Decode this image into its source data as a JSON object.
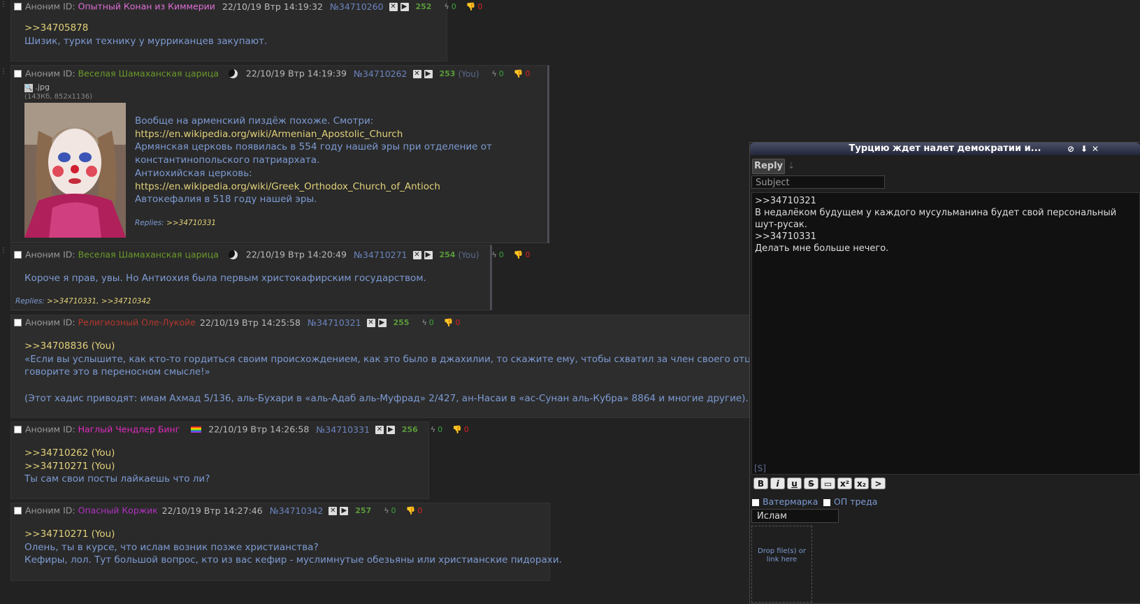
{
  "posts": [
    {
      "name": "Аноним",
      "id_label": "ID:",
      "id_name": "Опытный Конан из Киммерии",
      "date": "22/10/19 Втр 14:19:32",
      "num": "№34710260",
      "count": "252",
      "likes": "0",
      "dislikes": "0",
      "lines": [
        ">>34705878",
        "Шизик, турки технику у мурриканцев закупают."
      ]
    },
    {
      "name": "Аноним",
      "id_label": "ID:",
      "id_name": "Веселая Шамаханская царица",
      "date": "22/10/19 Втр 14:19:39",
      "num": "№34710262",
      "count": "253",
      "you": "(You)",
      "likes": "0",
      "dislikes": "0",
      "file_name": ".jpg",
      "file_info": "(143Кб, 852x1136)",
      "lines": [
        "Вообще на арменский пиздёж похоже. Смотри:",
        "https://en.wikipedia.org/wiki/Armenian_Apostolic_Church",
        "Армянская церковь появилась в 554 году нашей эры при отделение от",
        "константинопольского патриархата.",
        "Антиохийская церковь:",
        "https://en.wikipedia.org/wiki/Greek_Orthodox_Church_of_Antioch",
        "Автокефалия в 518 году нашей эры."
      ],
      "replies_label": "Replies:",
      "replies": ">>34710331"
    },
    {
      "name": "Аноним",
      "id_label": "ID:",
      "id_name": "Веселая Шамаханская царица",
      "date": "22/10/19 Втр 14:20:49",
      "num": "№34710271",
      "count": "254",
      "you": "(You)",
      "likes": "0",
      "dislikes": "0",
      "lines": [
        "Короче я прав, увы. Но Антиохия была первым христокафирским государством."
      ],
      "replies_label": "Replies:",
      "replies": ">>34710331, >>34710342"
    },
    {
      "name": "Аноним",
      "id_label": "ID:",
      "id_name": "Религиозный Оле-Лукойе",
      "date": "22/10/19 Втр 14:25:58",
      "num": "№34710321",
      "count": "255",
      "likes": "0",
      "dislikes": "0",
      "lines": [
        ">>34708836 (You)",
        "«Если вы услышите, как кто-то гордиться своим происхождением, как это было в джахилии, то скажите ему, чтобы схватил за член своего отца. И не",
        "говорите это в переносном смысле!»",
        "",
        "(Этот хадис приводят: имам Ахмад 5/136, аль-Бухари в «аль-Адаб аль-Муфрад» 2/427, ан-Насаи в «ас-Сунан аль-Кубра» 8864 и многие другие)."
      ]
    },
    {
      "name": "Аноним",
      "id_label": "ID:",
      "id_name": "Наглый Чендлер Бинг",
      "date": "22/10/19 Втр 14:26:58",
      "num": "№34710331",
      "count": "256",
      "likes": "0",
      "dislikes": "0",
      "lines": [
        ">>34710262 (You)",
        ">>34710271 (You)",
        "Ты сам свои посты лайкаешь что ли?"
      ]
    },
    {
      "name": "Аноним",
      "id_label": "ID:",
      "id_name": "Опасный Коржик",
      "date": "22/10/19 Втр 14:27:46",
      "num": "№34710342",
      "count": "257",
      "likes": "0",
      "dislikes": "0",
      "lines": [
        ">>34710271 (You)",
        "Олень, ты в курсе, что ислам возник позже христианства?",
        "Кефиры, лол. Тут большой вопрос, кто из вас кефир - муслимнутые обезьяны или христианские пидорахи."
      ]
    }
  ],
  "reply_window": {
    "title": "Турцию ждет налет демократии и...",
    "reply_button": "Reply",
    "subject_placeholder": "Subject",
    "message": ">>34710321\nВ недалёком будущем у каждого мусульманина будет свой персональный\nшут-русак.\n>>34710331\nДелать мне больше нечего.",
    "spoiler": "[S]",
    "format_buttons": [
      "B",
      "i",
      "u",
      "S",
      "▭",
      "x²",
      "x₂",
      ">"
    ],
    "watermark_label": "Ватермарка",
    "op_label": "ОП треда",
    "captcha_value": "Ислам",
    "drop_text_1": "Drop file(s) or",
    "drop_text_2": "link here"
  },
  "colors": {
    "background": "#222222",
    "post_bg": "#2a2a2a",
    "text": "#7d9bd3",
    "quote": "#e2d17a"
  }
}
